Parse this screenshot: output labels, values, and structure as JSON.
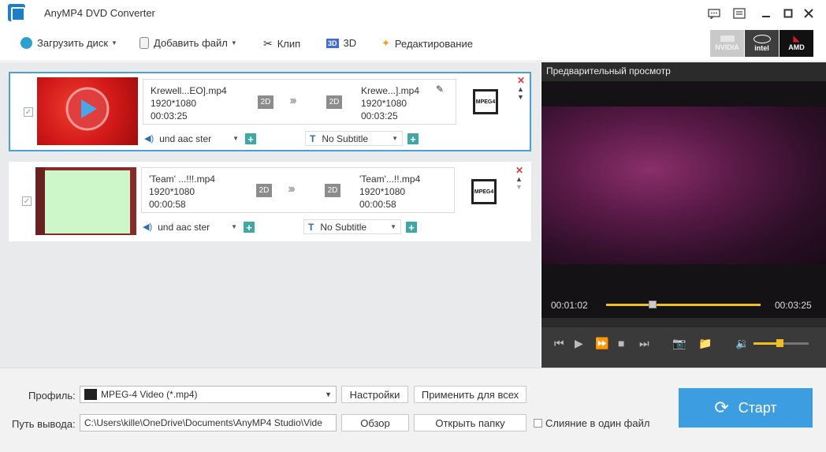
{
  "app": {
    "title": "AnyMP4 DVD Converter"
  },
  "window_controls": [
    "feedback-icon",
    "menu-icon",
    "minimize-icon",
    "maximize-icon",
    "close-icon"
  ],
  "toolbar": {
    "load_disc": "Загрузить диск",
    "add_file": "Добавить файл",
    "clip": "Клип",
    "threed": "3D",
    "edit": "Редактирование"
  },
  "gpu": {
    "nvidia": "NVIDIA",
    "intel": "intel",
    "amd": "AMD"
  },
  "files": [
    {
      "source_name": "Krewell...EO].mp4",
      "source_res": "1920*1080",
      "source_duration": "00:03:25",
      "badge_in": "2D",
      "badge_out": "2D",
      "output_name": "Krewe...].mp4",
      "output_res": "1920*1080",
      "output_duration": "00:03:25",
      "audio": "und aac ster",
      "subtitle": "No Subtitle",
      "format_icon": "MPEG4"
    },
    {
      "source_name": "'Team' ...!!!.mp4",
      "source_res": "1920*1080",
      "source_duration": "00:00:58",
      "badge_in": "2D",
      "badge_out": "2D",
      "output_name": "'Team'...!!.mp4",
      "output_res": "1920*1080",
      "output_duration": "00:00:58",
      "audio": "und aac ster",
      "subtitle": "No Subtitle",
      "format_icon": "MPEG4"
    }
  ],
  "preview": {
    "title": "Предварительный просмотр",
    "current_time": "00:01:02",
    "total_time": "00:03:25",
    "progress": 0.3,
    "volume": 0.47
  },
  "bottom": {
    "profile_label": "Профиль:",
    "profile_value": "MPEG-4 Video (*.mp4)",
    "settings": "Настройки",
    "apply_all": "Применить для всех",
    "output_label": "Путь вывода:",
    "output_value": "C:\\Users\\kille\\OneDrive\\Documents\\AnyMP4 Studio\\Vide",
    "browse": "Обзор",
    "open_folder": "Открыть папку",
    "merge": "Слияние в один файл",
    "start": "Старт"
  },
  "colors": {
    "accent": "#3c9ee0",
    "selected_border": "#4aa0d8",
    "progress": "#f0c020",
    "plus": "#3fa7a4"
  }
}
